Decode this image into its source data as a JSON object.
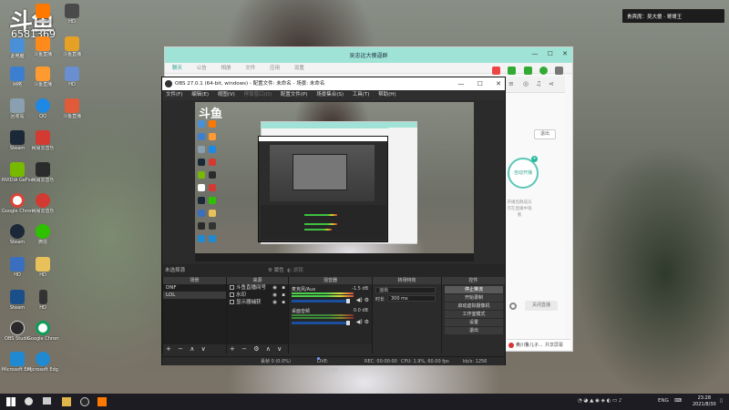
{
  "branding": {
    "logo_text": "斗鱼",
    "room_number": "6581369"
  },
  "notification": {
    "text": "贵宾席：吴大傻 · 哥哥王"
  },
  "desktop_icons": [
    {
      "label": "此电脑",
      "color": "#4a90d9"
    },
    {
      "label": "网络",
      "color": "#3c7fd0"
    },
    {
      "label": "回收站",
      "color": "#8aa0b0"
    },
    {
      "label": "Steam",
      "color": "#1b2838"
    },
    {
      "label": "NVIDIA GeForce Experience",
      "color": "#76b900"
    },
    {
      "label": "Google Chrome",
      "color": "#ffffff"
    },
    {
      "label": "Steam",
      "color": "#1b2838"
    },
    {
      "label": "HD",
      "color": "#444"
    },
    {
      "label": "网易云音乐",
      "color": "#d33a31"
    },
    {
      "label": "斗鱼直播",
      "color": "#ff7800"
    },
    {
      "label": "QQ",
      "color": "#1e88e5"
    },
    {
      "label": "微信",
      "color": "#2dc100"
    },
    {
      "label": "OBS Studio",
      "color": "#2a2a2a"
    },
    {
      "label": "Google Chrome",
      "color": "#ffffff"
    },
    {
      "label": "Microsoft Edge",
      "color": "#1f8ad2"
    }
  ],
  "chat_window": {
    "title": "吴忠远大傻逼群",
    "tabs": [
      "聊天",
      "公告",
      "相册",
      "文件",
      "应用",
      "设置"
    ],
    "exit_label": "退出",
    "live_label": "自动开播",
    "note": "开播后群成员可在直播中观看",
    "close_live_label": "关闭直播",
    "footer_user": "奥川鲁儿子...",
    "footer_share": "共享屏幕"
  },
  "obs": {
    "title": "OBS 27.0.1 (64-bit, windows) - 配置文件: 未命名 - 场景: 未命名",
    "menu": [
      "文件(F)",
      "编辑(E)",
      "视图(V)",
      "停靠窗口(D)",
      "配置文件(P)",
      "场景集合(S)",
      "工具(T)",
      "帮助(H)"
    ],
    "scene_bar": {
      "label": "未选择源",
      "props": "属性",
      "filters": "滤镜"
    },
    "docks": {
      "scenes": {
        "header": "场景",
        "items": [
          "DNF",
          "LOL"
        ]
      },
      "sources": {
        "header": "来源",
        "items": [
          "斗鱼直播间号",
          "水印",
          "显示器捕获"
        ]
      },
      "mixer": {
        "header": "混音器",
        "channels": [
          {
            "name": "麦克风/Aux",
            "db": "-1.5 dB"
          },
          {
            "name": "桌面音频",
            "db": "0.0 dB"
          }
        ]
      },
      "transitions": {
        "header": "转场特效",
        "type": "淡出",
        "duration_label": "时长",
        "duration_value": "300 ms"
      },
      "controls": {
        "header": "控件",
        "buttons": [
          "停止推流",
          "开始录制",
          "启动虚拟摄像机",
          "工作室模式",
          "设置",
          "退出"
        ]
      }
    },
    "status": {
      "dropped": "丢帧 0 (0.0%)",
      "live": "LIVE: 00:00:00",
      "rec": "REC: 00:00:00",
      "cpu": "CPU: 1.9%, 60.00 fps",
      "kbps": "kb/s: 1256"
    }
  },
  "taskbar": {
    "lang": "ENG",
    "time": "23:28",
    "date": "2021/8/30"
  }
}
